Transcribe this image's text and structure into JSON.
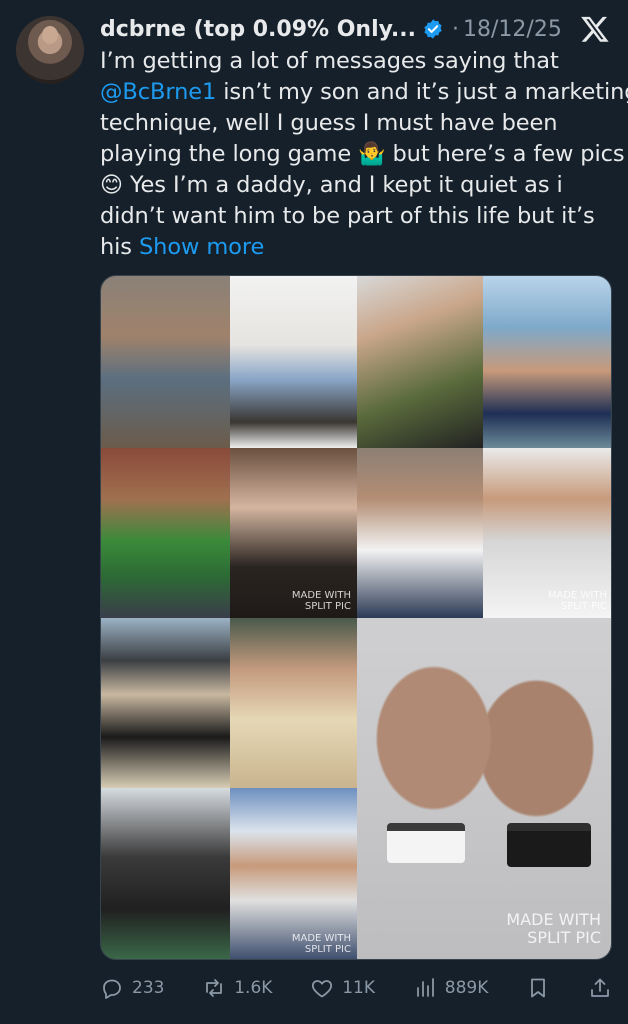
{
  "author": {
    "display_name": "dcbrne (top 0.09% Only...",
    "verified": true,
    "separator": "·",
    "date": "18/12/25"
  },
  "tweet": {
    "line1": "I’m getting a lot of messages saying that",
    "mention": "@BcBrne1",
    "line2_rest": " isn’t my son and it’s just a marketing",
    "line3": "technique, well I guess I must have been",
    "line4_a": "playing the long game ",
    "line4_emoji": "🤷‍♂️",
    "line4_b": " but here’s a few pics",
    "line5_emoji": "😊",
    "line5_text": " Yes I’m a daddy, and I kept it quiet as i",
    "line6": "didn’t want him to be part of this life but it’s",
    "line7": "his ",
    "show_more": "Show more"
  },
  "media": {
    "watermark_small": "MADE WITH SPLIT PIC",
    "watermark_large": "MADE WITH SPLIT PIC"
  },
  "actions": {
    "replies": "233",
    "reposts": "1.6K",
    "likes": "11K",
    "views": "889K"
  },
  "colors": {
    "background": "#15202b",
    "accent": "#1d9bf0",
    "muted": "#8b98a5"
  }
}
